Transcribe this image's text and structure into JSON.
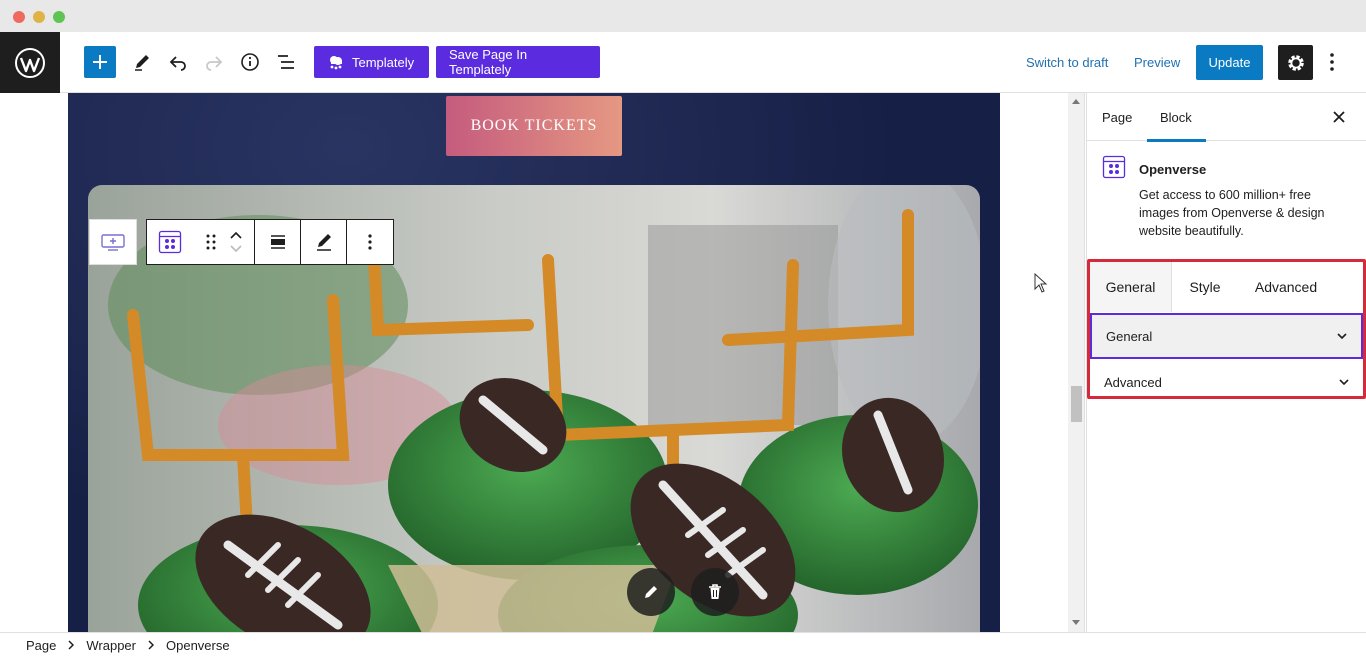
{
  "toolbar": {
    "templately_label": "Templately",
    "save_templately_label": "Save Page In Templately",
    "switch_draft_label": "Switch to draft",
    "preview_label": "Preview",
    "update_label": "Update",
    "icons": [
      "wordpress-logo-icon",
      "plus-icon",
      "pencil-icon",
      "undo-icon",
      "redo-icon",
      "info-icon",
      "list-view-icon",
      "templately-cloud-icon",
      "gear-icon",
      "kebab-icon"
    ]
  },
  "canvas": {
    "book_button_label": "BOOK TICKETS",
    "block_toolbar_icons": [
      "templately-add-icon",
      "openverse-block-icon",
      "drag-handle-icon",
      "chevron-up-icon",
      "chevron-down-icon",
      "align-icon",
      "edit-pencil-icon",
      "more-icon"
    ],
    "image_action_icons": [
      "pencil-icon",
      "trash-icon"
    ]
  },
  "sidebar": {
    "tabs": [
      "Page",
      "Block"
    ],
    "active_tab": "Block",
    "block_name": "Openverse",
    "block_description": "Get access to 600 million+ free images from Openverse & design website beautifully.",
    "panel_tabs": [
      "General",
      "Style",
      "Advanced"
    ],
    "active_panel_tab": "General",
    "accordion": [
      {
        "label": "General",
        "open": true
      },
      {
        "label": "Advanced",
        "open": false
      }
    ],
    "highlight_color": "#d52a3a",
    "accent_color": "#5b2be0"
  },
  "breadcrumb": [
    "Page",
    "Wrapper",
    "Openverse"
  ]
}
